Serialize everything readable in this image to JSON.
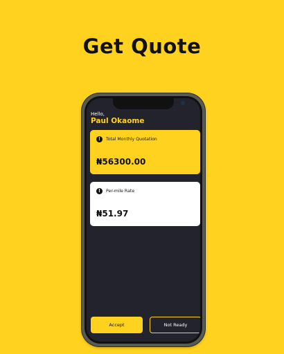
{
  "headline": "Get Quote",
  "greeting": "Hello,",
  "user_name": "Paul Okaome",
  "cards": [
    {
      "label": "Total Monthly Quotation",
      "value": "₦56300.00",
      "icon": "info-icon"
    },
    {
      "label": "Per-mile Rate",
      "value": "₦51.97",
      "icon": "info-icon"
    }
  ],
  "buttons": {
    "accept": "Accept",
    "not_ready": "Not Ready"
  },
  "colors": {
    "brand_yellow": "#FFD21F",
    "screen_dark": "#23232D",
    "card_white": "#FFFFFF"
  }
}
